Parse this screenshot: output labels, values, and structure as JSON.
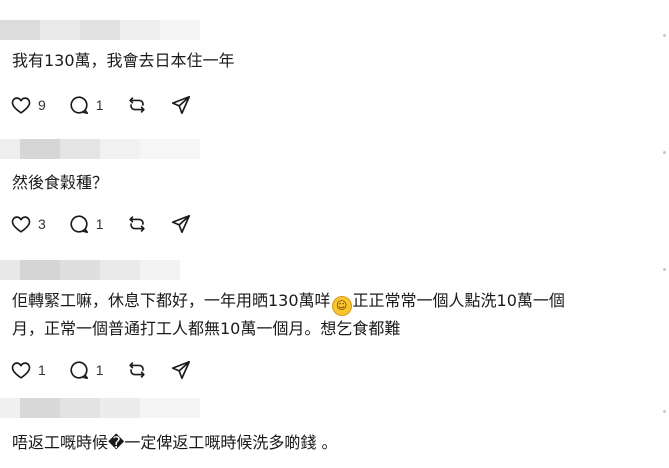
{
  "comments": [
    {
      "text": "我有130萬，我會去日本住一年",
      "likes": "9",
      "replies": "1"
    },
    {
      "text": "然後食穀種？",
      "likes": "3",
      "replies": "1"
    },
    {
      "text_line1_a": "佢轉緊工嘛，休息下都好，一年用晒130萬咩",
      "emoji": "😂",
      "text_line1_b": "正正常常一個人點洗10萬一個",
      "text_line2": "月，正常一個普通打工人都無10萬一個月。想乞食都難",
      "likes": "1",
      "replies": "1"
    },
    {
      "text": "唔返工嘅時候�一定俾返工嘅時候洗多啲錢 。"
    }
  ],
  "icons": {
    "like": "heart-icon",
    "reply": "comment-bubble-icon",
    "repost": "repost-icon",
    "share": "send-icon"
  },
  "colors": {
    "icon": "#1a1a1a",
    "text": "#1a1a1a",
    "blur_dark": "#d9d9d9",
    "blur_light": "#eeeeee"
  }
}
